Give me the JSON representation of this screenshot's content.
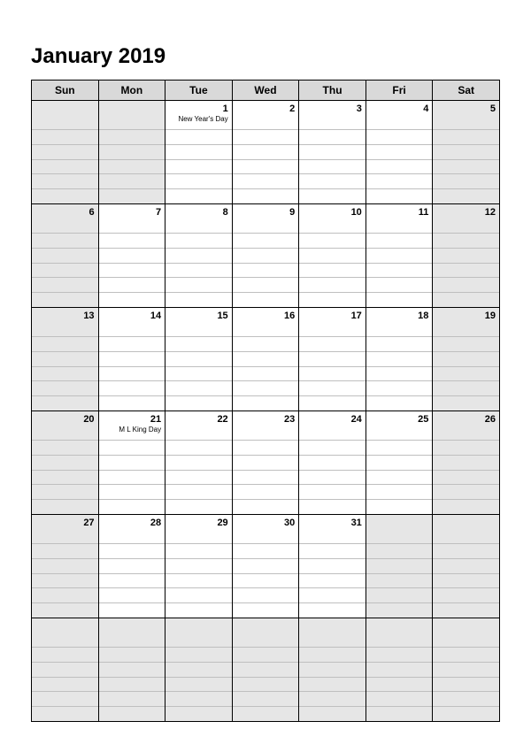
{
  "title": "January 2019",
  "weekdays": [
    "Sun",
    "Mon",
    "Tue",
    "Wed",
    "Thu",
    "Fri",
    "Sat"
  ],
  "weeks": [
    [
      {
        "day": "",
        "blank": true,
        "weekend": true
      },
      {
        "day": "",
        "blank": true
      },
      {
        "day": "1",
        "event": "New Year's Day"
      },
      {
        "day": "2"
      },
      {
        "day": "3"
      },
      {
        "day": "4"
      },
      {
        "day": "5",
        "weekend": true
      }
    ],
    [
      {
        "day": "6",
        "weekend": true
      },
      {
        "day": "7"
      },
      {
        "day": "8"
      },
      {
        "day": "9"
      },
      {
        "day": "10"
      },
      {
        "day": "11"
      },
      {
        "day": "12",
        "weekend": true
      }
    ],
    [
      {
        "day": "13",
        "weekend": true
      },
      {
        "day": "14"
      },
      {
        "day": "15"
      },
      {
        "day": "16"
      },
      {
        "day": "17"
      },
      {
        "day": "18"
      },
      {
        "day": "19",
        "weekend": true
      }
    ],
    [
      {
        "day": "20",
        "weekend": true
      },
      {
        "day": "21",
        "event": "M L King Day"
      },
      {
        "day": "22"
      },
      {
        "day": "23"
      },
      {
        "day": "24"
      },
      {
        "day": "25"
      },
      {
        "day": "26",
        "weekend": true
      }
    ],
    [
      {
        "day": "27",
        "weekend": true
      },
      {
        "day": "28"
      },
      {
        "day": "29"
      },
      {
        "day": "30"
      },
      {
        "day": "31"
      },
      {
        "day": "",
        "blank": true
      },
      {
        "day": "",
        "blank": true,
        "weekend": true
      }
    ],
    [
      {
        "day": "",
        "blank": true,
        "weekend": true
      },
      {
        "day": "",
        "blank": true
      },
      {
        "day": "",
        "blank": true
      },
      {
        "day": "",
        "blank": true
      },
      {
        "day": "",
        "blank": true
      },
      {
        "day": "",
        "blank": true
      },
      {
        "day": "",
        "blank": true,
        "weekend": true
      }
    ]
  ]
}
